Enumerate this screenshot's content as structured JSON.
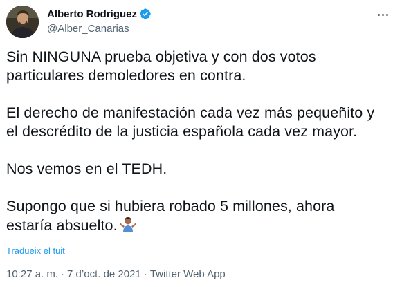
{
  "author": {
    "display_name": "Alberto Rodríguez",
    "handle": "@Alber_Canarias",
    "verified": true,
    "avatar_icon": "user-avatar-photo"
  },
  "colors": {
    "verified_badge": "#1d9bf0",
    "link": "#1d9bf0",
    "secondary_text": "#536471",
    "primary_text": "#0f1419"
  },
  "tweet": {
    "paragraphs": [
      "Sin NINGUNA prueba objetiva y con dos votos\nparticulares demoledores en contra.",
      "El derecho de manifestación cada vez más pequeñito y\nel descrédito de la justicia española cada vez mayor.",
      "Nos vemos en el TEDH.",
      "Supongo que si hubiera robado 5 millones, ahora\nestaría absuelto."
    ],
    "trailing_emoji": "person-shrugging-emoji",
    "translate_label": "Tradueix el tuit"
  },
  "meta": {
    "time": "10:27 a. m.",
    "separator": "·",
    "date": "7 d’oct. de 2021",
    "source": "Twitter Web App"
  },
  "more_icon": "more-horizontal-icon"
}
